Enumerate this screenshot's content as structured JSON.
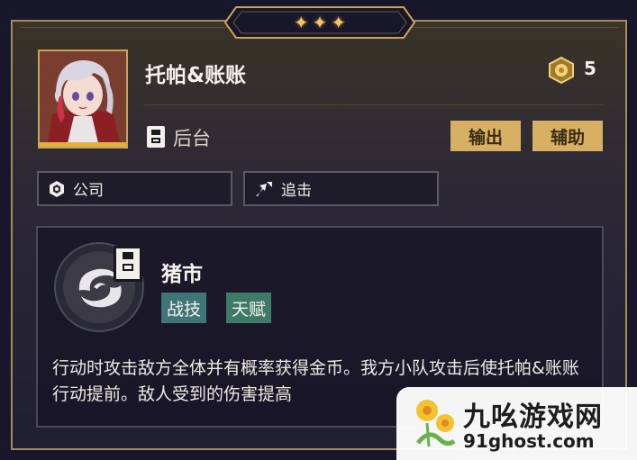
{
  "rarity": {
    "stars": [
      "✦",
      "✦",
      "✦"
    ]
  },
  "character": {
    "name": "托帕&账账",
    "cost": "5",
    "position_label": "后台",
    "roles": [
      "输出",
      "辅助"
    ],
    "traits": [
      {
        "icon": "company-icon",
        "label": "公司"
      },
      {
        "icon": "follow-up-icon",
        "label": "追击"
      }
    ]
  },
  "skill": {
    "name": "猪市",
    "types": [
      {
        "label": "战技",
        "color": "#3f7478"
      },
      {
        "label": "天赋",
        "color": "#3e7a68"
      }
    ],
    "description": "行动时攻击敌方全体并有概率获得金币。我方小队攻击后使托帕&账账行动提前。敌人受到的伤害提高"
  },
  "watermark": {
    "cn": "九吆游戏网",
    "en": "91ghost.com"
  },
  "colors": {
    "accent_gold": "#d8b063",
    "frame_gold": "#a38c5c"
  }
}
